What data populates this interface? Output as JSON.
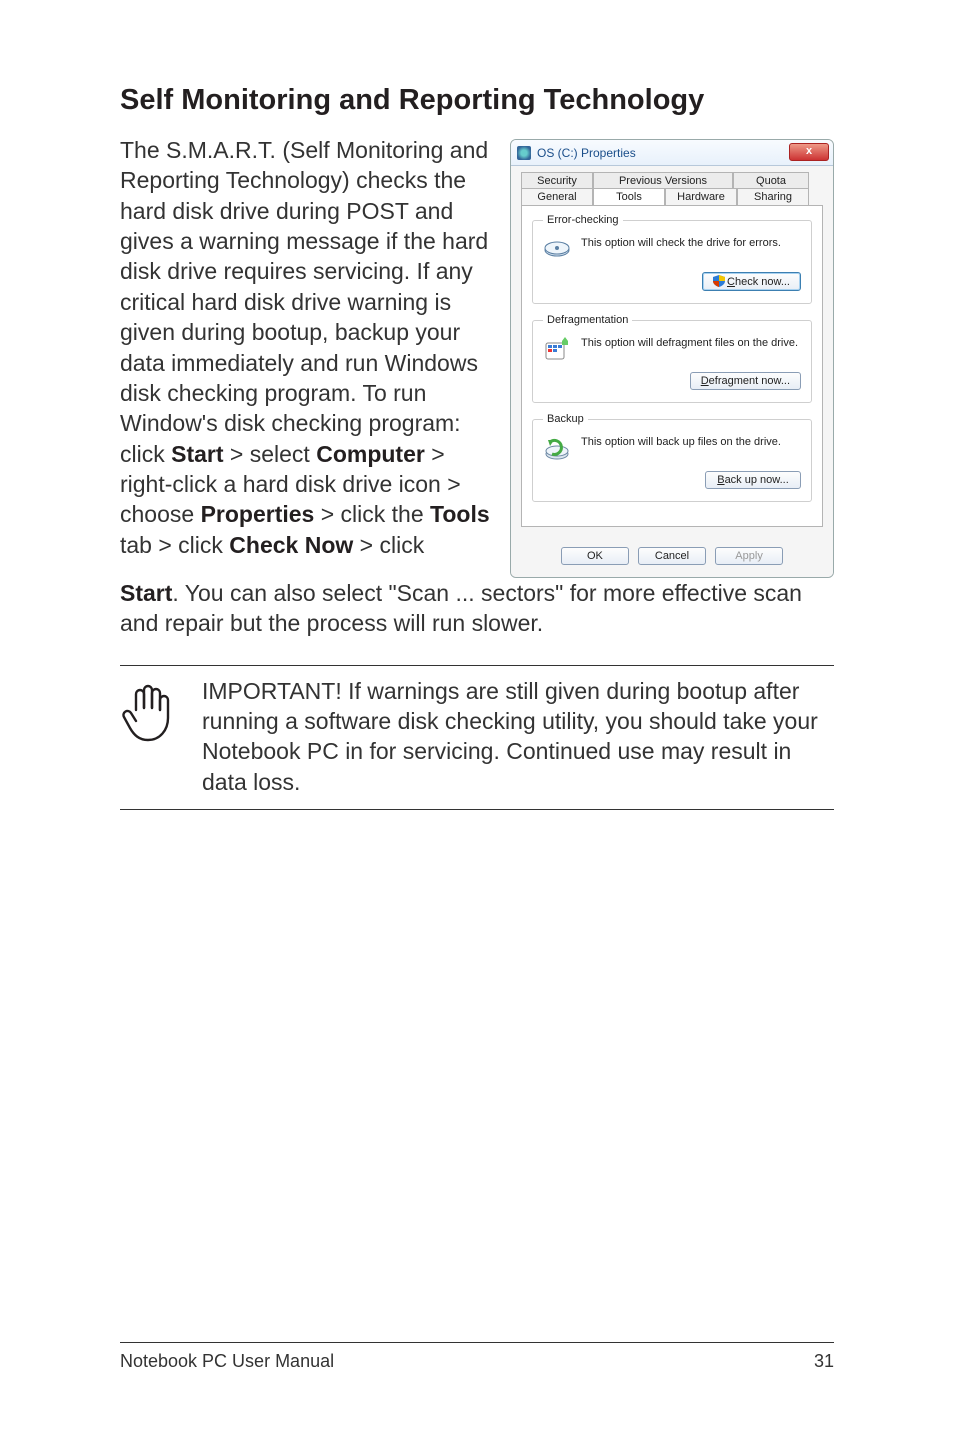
{
  "heading": "Self Monitoring and Reporting Technology",
  "body": {
    "p1_a": "The S.M.A.R.T. (Self Monitoring and Reporting Technology) checks the hard disk drive during POST and gives a warning message if the hard disk drive requires servicing. If any critical hard disk drive warning is given during bootup, backup your data immediately and run Windows disk checking program. To run Window's disk checking program: click ",
    "start": "Start",
    "p1_b": " > select ",
    "computer": "Computer",
    "p1_c": " > right-click a hard disk drive icon > choose ",
    "properties": "Properties",
    "p1_d": " > click the ",
    "tools": "Tools",
    "p1_e": " tab > click ",
    "checknow": "Check Now",
    "p1_f": " > click ",
    "start2": "Start",
    "p1_g": ". You can also select \"Scan ... sectors\" for more effective scan and repair but the process will run slower."
  },
  "dialog": {
    "title": "OS (C:) Properties",
    "close": "x",
    "tabs_back": {
      "security": "Security",
      "prev": "Previous Versions",
      "quota": "Quota"
    },
    "tabs_front": {
      "general": "General",
      "tools": "Tools",
      "hardware": "Hardware",
      "sharing": "Sharing"
    },
    "error_checking": {
      "legend": "Error-checking",
      "text": "This option will check the drive for errors.",
      "btn_prefix": "C",
      "btn_rest": "heck now..."
    },
    "defrag": {
      "legend": "Defragmentation",
      "text": "This option will defragment files on the drive.",
      "btn_prefix": "D",
      "btn_rest": "efragment now..."
    },
    "backup": {
      "legend": "Backup",
      "text": "This option will back up files on the drive.",
      "btn_prefix": "B",
      "btn_rest": "ack up now..."
    },
    "footer": {
      "ok": "OK",
      "cancel": "Cancel",
      "apply": "Apply"
    }
  },
  "note": "IMPORTANT! If warnings are still given during bootup after running a software disk checking utility, you should take your Notebook PC in for servicing. Continued use may result in data loss.",
  "footer": {
    "left": "Notebook PC User Manual",
    "right": "31"
  }
}
